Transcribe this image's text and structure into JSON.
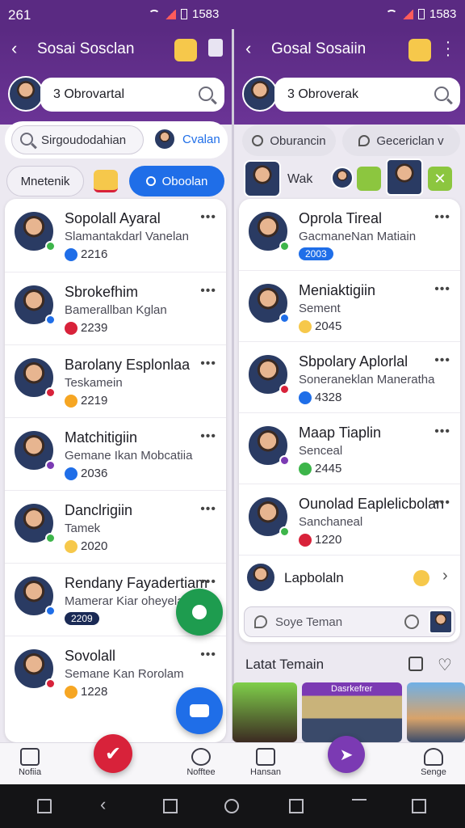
{
  "status": {
    "time": "261",
    "right_time": "1583",
    "right_time_2": "1583"
  },
  "left": {
    "title": "Sosai Sosclan",
    "search_text": "3 Obrovartal",
    "filter_input": "Sirgoudodahian",
    "filter_chip": "Cvalan",
    "tab_outline": "Mnetenik",
    "tab_active": "Oboolan",
    "items": [
      {
        "name": "Sopolall Ayaral",
        "sub": "Slamantakdarl Vanelan",
        "count": "2216",
        "emoji": "blue-icon"
      },
      {
        "name": "Sbrokefhim",
        "sub": "Bamerallban Kglan",
        "count": "2239",
        "emoji": "red-icon"
      },
      {
        "name": "Barolany Esplonlaa",
        "sub": "Teskamein",
        "count": "2219",
        "emoji": "laugh-icon"
      },
      {
        "name": "Matchitigiin",
        "sub": "Gemane Ikan Mobcatiia",
        "count": "2036",
        "emoji": "blue-icon"
      },
      {
        "name": "Danclrigiin",
        "sub": "Tamek",
        "count": "2020",
        "emoji": "smile-icon"
      },
      {
        "name": "Rendany Fayadertiam",
        "sub": "Mamerar Kiar oheyelan",
        "count": "2209",
        "emoji": "tag"
      },
      {
        "name": "Sovolall",
        "sub": "Semane Kan Rorolam",
        "count": "1228",
        "emoji": "laugh-icon"
      }
    ]
  },
  "right": {
    "title": "Gosal Sosaiin",
    "search_text": "3 Obroverak",
    "chip1": "Oburancin",
    "chip2": "Gecericlan v",
    "story_label": "Wak",
    "items": [
      {
        "name": "Oprola Tireal",
        "sub": "GacmaneNan Matiain",
        "count": "2003",
        "emoji": "tag"
      },
      {
        "name": "Meniaktigiin",
        "sub": "Sement",
        "count": "2045",
        "emoji": "smile-icon"
      },
      {
        "name": "Sbpolary Aplorlal",
        "sub": "Soneraneklan Maneratha",
        "count": "4328",
        "emoji": "blue-icon"
      },
      {
        "name": "Maap Tiaplin",
        "sub": "Senceal",
        "count": "2445",
        "emoji": "green-icon"
      },
      {
        "name": "Ounolad Eaplelicbolan",
        "sub": "Sanchaneal",
        "count": "1220",
        "emoji": "red-icon"
      }
    ],
    "last_item": "Lapbolaln",
    "compose_placeholder": "Soye Teman",
    "section_title": "Latat Temain",
    "thumb_label": "Dasrkefrer"
  },
  "tabs": [
    "Nofiia",
    "Nofftee",
    "Hansan",
    "Senge"
  ],
  "colors": {
    "brand": "#5a2a82",
    "accent_blue": "#1f6ee8",
    "fab_green": "#1e9c4f",
    "fab_red": "#d8223a",
    "fab_purple": "#7b3ab3"
  }
}
